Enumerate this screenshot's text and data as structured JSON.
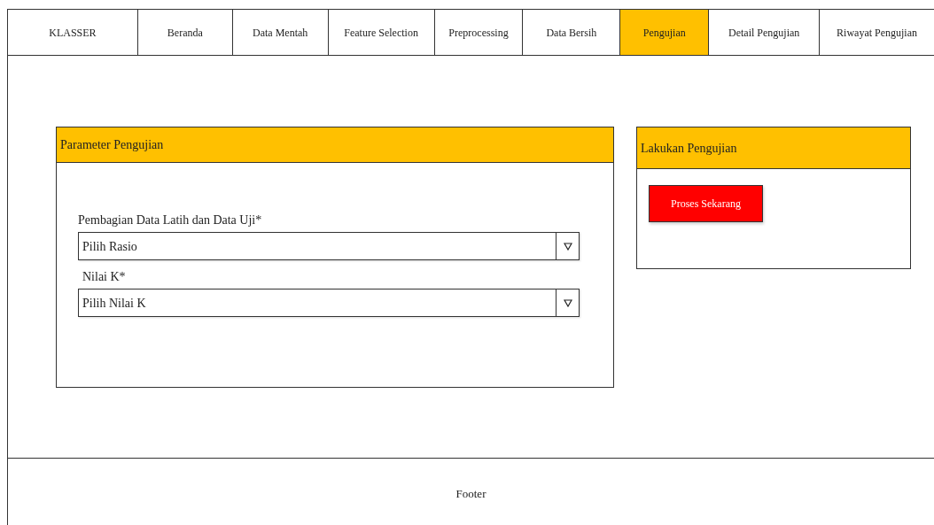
{
  "nav": {
    "brand": "KLASSER",
    "tabs": [
      {
        "label": "Beranda",
        "selected": false
      },
      {
        "label": "Data Mentah",
        "selected": false
      },
      {
        "label": "Feature Selection",
        "selected": false
      },
      {
        "label": "Preprocessing",
        "selected": false
      },
      {
        "label": "Data Bersih",
        "selected": false
      },
      {
        "label": "Pengujian",
        "selected": true
      },
      {
        "label": "Detail Pengujian",
        "selected": false
      },
      {
        "label": "Riwayat Pengujian",
        "selected": false
      }
    ]
  },
  "parameter_panel": {
    "title": "Parameter Pengujian",
    "fields": [
      {
        "label": "Pembagian Data Latih dan Data Uji*",
        "value": "Pilih Rasio"
      },
      {
        "label": "Nilai K*",
        "value": "Pilih Nilai K"
      }
    ]
  },
  "action_panel": {
    "title": "Lakukan Pengujian",
    "button": "Proses Sekarang"
  },
  "footer": "Footer"
}
